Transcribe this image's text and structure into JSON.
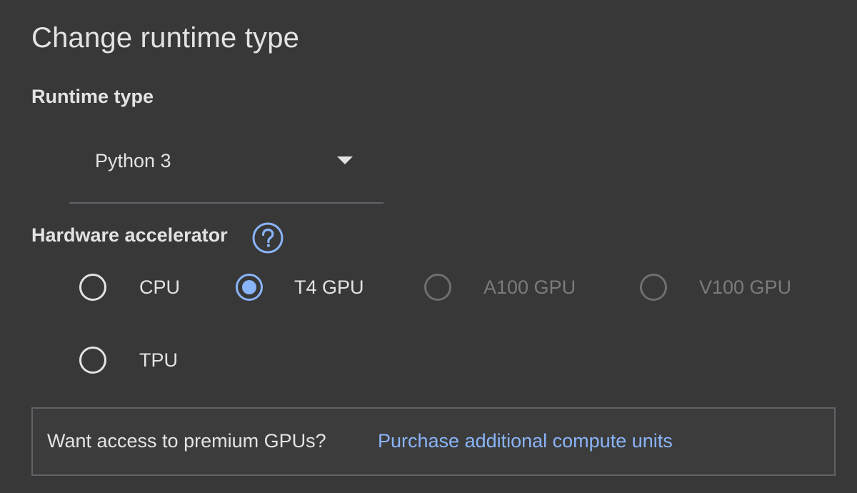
{
  "dialog": {
    "title": "Change runtime type"
  },
  "runtime": {
    "label": "Runtime type",
    "selected_value": "Python 3",
    "dropdown_icon": "chevron-down-icon"
  },
  "hardware": {
    "label": "Hardware accelerator",
    "help_icon": "help-circle-icon",
    "options": [
      {
        "label": "CPU",
        "checked": false,
        "disabled": false
      },
      {
        "label": "T4 GPU",
        "checked": true,
        "disabled": false
      },
      {
        "label": "A100 GPU",
        "checked": false,
        "disabled": true
      },
      {
        "label": "V100 GPU",
        "checked": false,
        "disabled": true
      },
      {
        "label": "TPU",
        "checked": false,
        "disabled": false
      }
    ]
  },
  "promo": {
    "text": "Want access to premium GPUs?",
    "link": "Purchase additional compute units"
  },
  "colors": {
    "background": "#383838",
    "accent": "#8ab4f8",
    "text": "#e3e3e3",
    "disabled_text": "#7b7b7b"
  }
}
